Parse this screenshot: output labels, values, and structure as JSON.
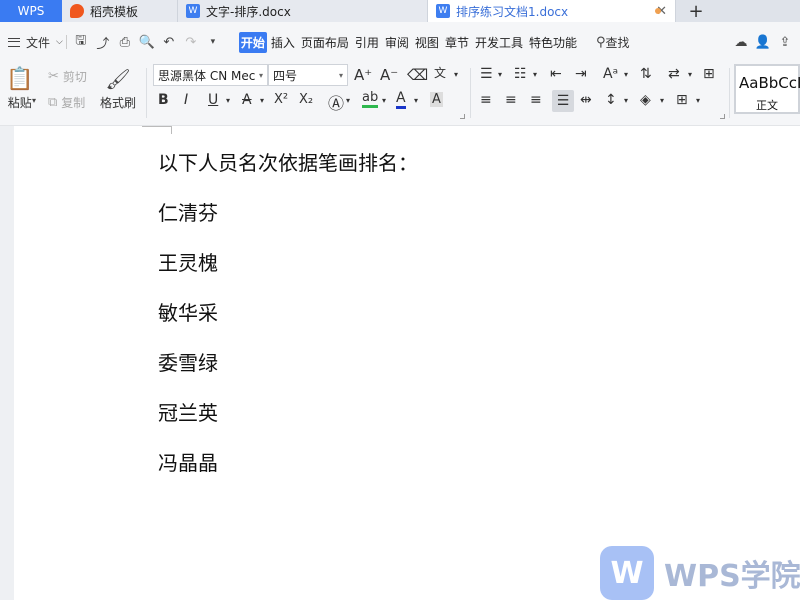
{
  "tabs": {
    "app_label": "WPS",
    "items": [
      {
        "label": "稻壳模板",
        "icon": "docer-icon"
      },
      {
        "label": "文字-排序.docx",
        "icon": "word-doc-icon"
      },
      {
        "label": "排序练习文档1.docx",
        "icon": "word-doc-icon",
        "active": true
      }
    ],
    "close_glyph": "✕",
    "new_tab_glyph": "+"
  },
  "menubar": {
    "file_label": "文件",
    "tabs": [
      "开始",
      "插入",
      "页面布局",
      "引用",
      "审阅",
      "视图",
      "章节",
      "开发工具",
      "特色功能"
    ],
    "active_tab": "开始",
    "search_label": "查找"
  },
  "ribbon": {
    "paste_label": "粘贴",
    "cut_label": "剪切",
    "copy_label": "复制",
    "format_painter_label": "格式刷",
    "font_name": "思源黑体 CN Mec",
    "font_size": "四号",
    "style_sample": "AaBbCcI",
    "style_name": "正文",
    "bold": "B",
    "italic": "I",
    "underline": "U",
    "strike": "A",
    "superscript": "X²",
    "subscript": "X₂",
    "phonetic": "文",
    "grow_font": "A⁺",
    "shrink_font": "A⁻"
  },
  "document": {
    "lines": [
      "以下人员名次依据笔画排名：",
      "仁清芬",
      "王灵槐",
      "敏华采",
      "委雪绿",
      "冠兰英",
      "冯晶晶"
    ]
  },
  "watermark": {
    "text": "WPS学院",
    "logo_glyph": "W"
  },
  "colors": {
    "accent": "#3a7bf2",
    "tabbar_bg": "#dfe3ea",
    "ribbon_bg": "#f5f6f8",
    "highlight_green": "#2fb84f",
    "font_color_blue": "#1a36c9"
  }
}
